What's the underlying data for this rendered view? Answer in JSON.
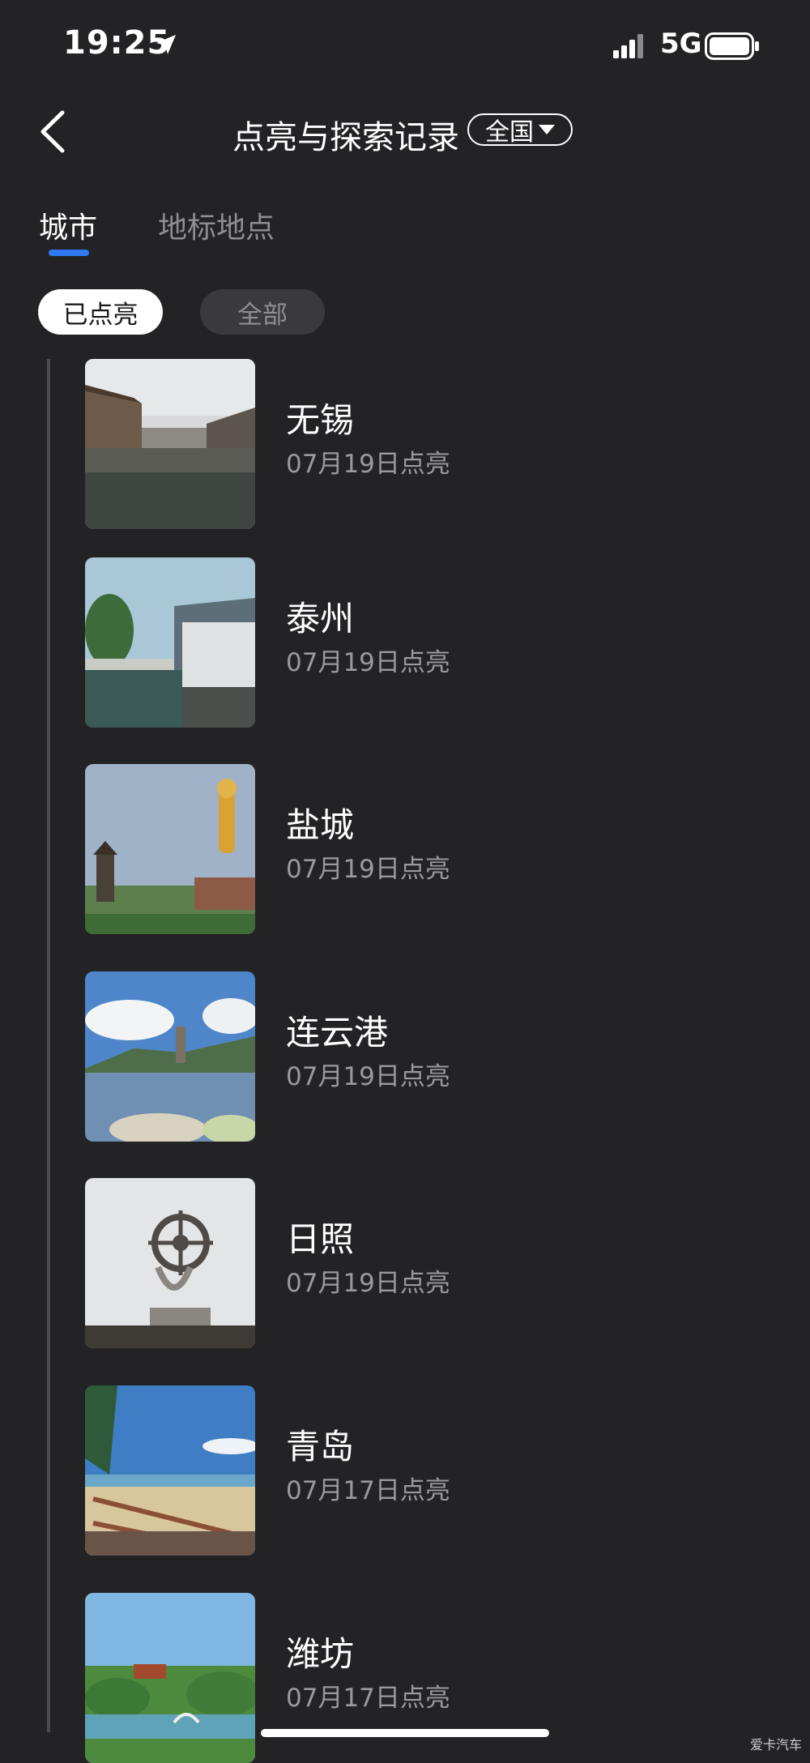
{
  "status_bar": {
    "time": "19:25",
    "network": "5G"
  },
  "header": {
    "title": "点亮与探索记录",
    "scope": "全国"
  },
  "tabs": [
    {
      "label": "城市"
    },
    {
      "label": "地标地点"
    }
  ],
  "filters": [
    {
      "label": "已点亮"
    },
    {
      "label": "全部"
    }
  ],
  "cities": [
    {
      "name": "无锡",
      "date": "07月19日点亮"
    },
    {
      "name": "泰州",
      "date": "07月19日点亮"
    },
    {
      "name": "盐城",
      "date": "07月19日点亮"
    },
    {
      "name": "连云港",
      "date": "07月19日点亮"
    },
    {
      "name": "日照",
      "date": "07月19日点亮"
    },
    {
      "name": "青岛",
      "date": "07月17日点亮"
    },
    {
      "name": "潍坊",
      "date": "07月17日点亮"
    }
  ],
  "watermark": "爱卡汽车",
  "colors": {
    "background": "#232224",
    "accent": "#2f7af2",
    "muted_text": "#9a999c"
  }
}
